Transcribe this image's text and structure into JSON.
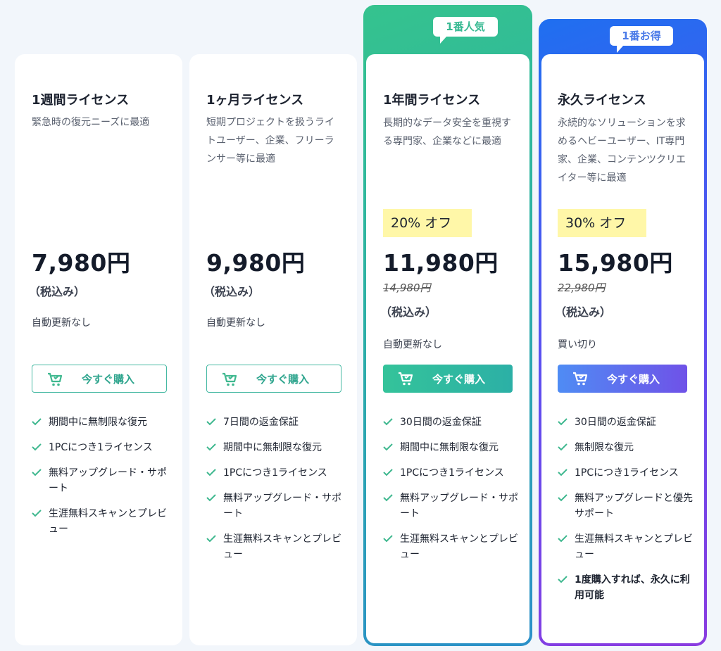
{
  "colors": {
    "green_accent": "#35c38e",
    "purple_accent": "#5b4ff0",
    "discount_bg": "#fff7a8",
    "check": "#3fb88f"
  },
  "plans": [
    {
      "title": "1週間ライセンス",
      "desc": "緊急時の復元ニーズに最適",
      "price": "7,980円",
      "tax": "（税込み）",
      "renew": "自動更新なし",
      "button": "今すぐ購入",
      "features": [
        "期間中に無制限な復元",
        "1PCにつき1ライセンス",
        "無料アップグレード・サポート",
        "生涯無料スキャンとプレビュー"
      ]
    },
    {
      "title": "1ヶ月ライセンス",
      "desc": "短期プロジェクトを扱うライトユーザー、企業、フリーランサー等に最適",
      "price": "9,980円",
      "tax": "（税込み）",
      "renew": "自動更新なし",
      "button": "今すぐ購入",
      "features": [
        "7日間の返金保証",
        "期間中に無制限な復元",
        "1PCにつき1ライセンス",
        "無料アップグレード・サポート",
        "生涯無料スキャンとプレビュー"
      ]
    },
    {
      "badge": "1番人気",
      "title": "1年間ライセンス",
      "desc": "長期的なデータ安全を重視する専門家、企業などに最適",
      "discount": "20% オフ",
      "price": "11,980円",
      "original_price": "14,980円",
      "tax": "（税込み）",
      "renew": "自動更新なし",
      "button": "今すぐ購入",
      "features": [
        "30日間の返金保証",
        "期間中に無制限な復元",
        "1PCにつき1ライセンス",
        "無料アップグレード・サポート",
        "生涯無料スキャンとプレビュー"
      ]
    },
    {
      "badge": "1番お得",
      "title": "永久ライセンス",
      "desc": "永続的なソリューションを求めるヘビーユーザー、IT専門家、企業、コンテンツクリエイター等に最適",
      "discount": "30% オフ",
      "price": "15,980円",
      "original_price": "22,980円",
      "tax": "（税込み）",
      "renew": "買い切り",
      "button": "今すぐ購入",
      "features": [
        "30日間の返金保証",
        "無制限な復元",
        "1PCにつき1ライセンス",
        "無料アップグレードと優先サポート",
        "生涯無料スキャンとプレビュー",
        "1度購入すれば、永久に利用可能"
      ]
    }
  ]
}
